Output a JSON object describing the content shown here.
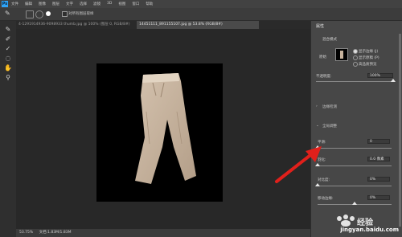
{
  "app": {
    "logo": "Ps"
  },
  "menu": [
    "文件",
    "编辑",
    "图像",
    "图层",
    "文字",
    "选择",
    "滤镜",
    "3D",
    "视图",
    "窗口",
    "帮助"
  ],
  "options": {
    "checkbox_label": "对所有图层取样"
  },
  "tabs": [
    {
      "label": "4-1291914936-9098933 thumb.jpg @ 100% (图层 0, RGB/8#)",
      "active": false
    },
    {
      "label": "14451111_891155107.jpg @ 53.8% (RGB/8#)",
      "active": true
    }
  ],
  "status": {
    "zoom": "53.75%",
    "doc": "文档:1.83M/1.83M"
  },
  "panel": {
    "title": "属性",
    "subtitle": "混合模式",
    "thumb_label": "原始",
    "options": [
      "显示边缘 (J)",
      "显示原稿 (P)",
      "高品质预览"
    ],
    "opacity_label": "不透明度:",
    "opacity_value": "100%",
    "section_edge": "边缘检测",
    "section_global": "全局调整",
    "smooth_label": "平滑:",
    "smooth_value": "0",
    "feather_label": "羽化:",
    "feather_value": "0.0 像素",
    "contrast_label": "对比度:",
    "contrast_value": "0%",
    "shift_label": "移动边缘:",
    "shift_value": "0%"
  },
  "levels": {
    "smooth": 0,
    "feather": 0,
    "contrast": 0,
    "shift": 0,
    "opacity": 100
  },
  "watermark": "jingyan.baidu.com",
  "colors": {
    "arrow": "#e0201b",
    "canvas": "#000000",
    "pants": "#c8b4a0"
  },
  "icons": [
    "brush-icon",
    "quick-select-icon",
    "magic-wand-icon",
    "lasso-icon",
    "hand-icon",
    "zoom-icon"
  ]
}
